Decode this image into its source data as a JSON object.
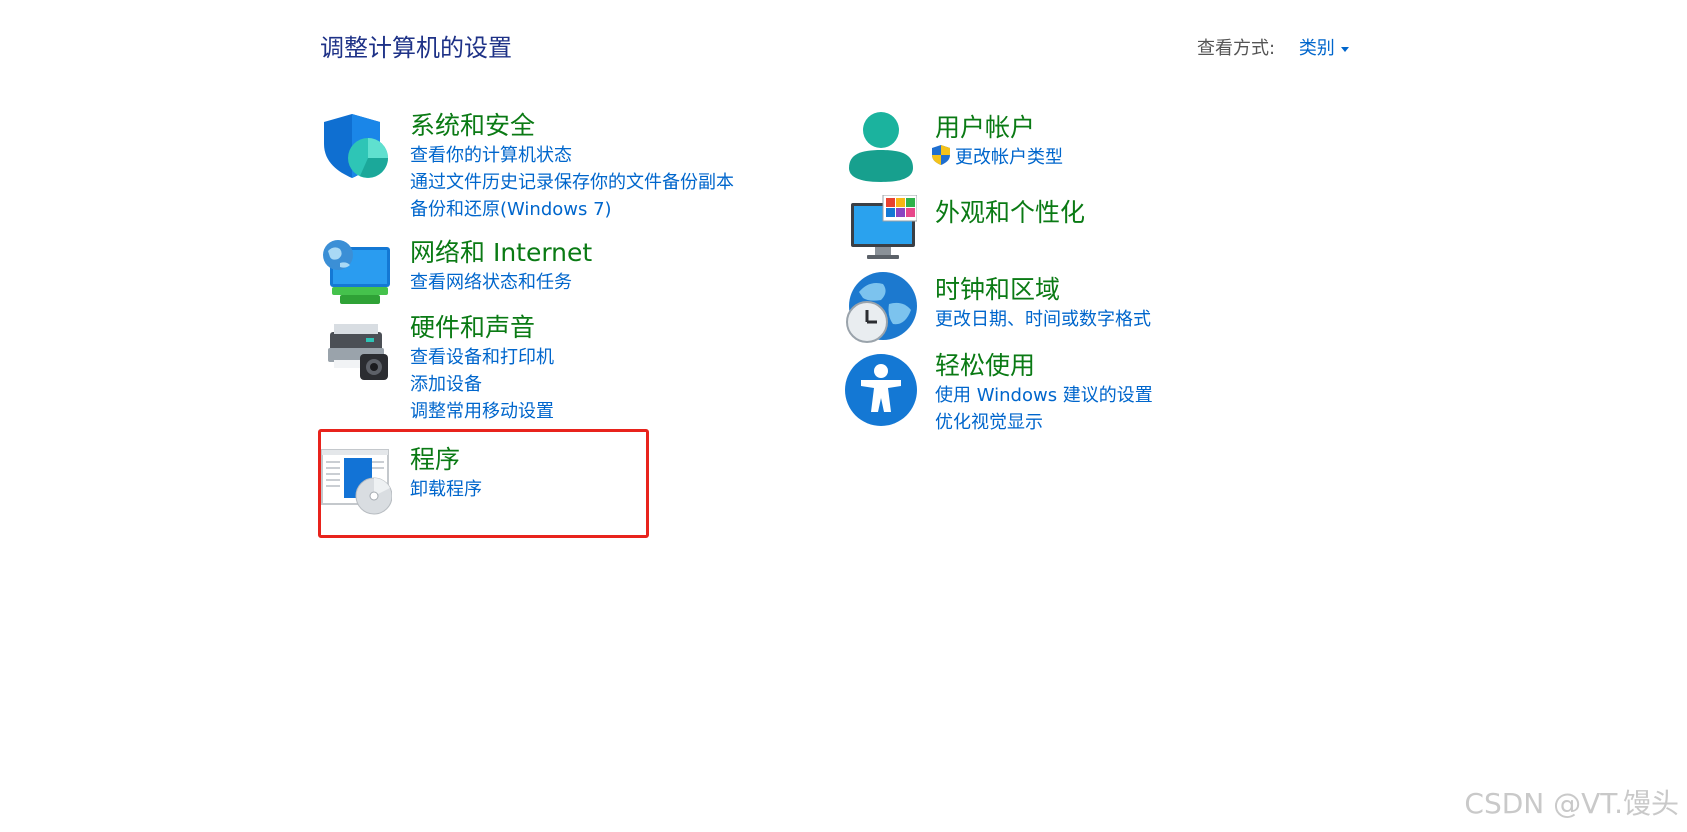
{
  "header": {
    "title": "调整计算机的设置",
    "view_by_label": "查看方式:",
    "view_by_value": "类别"
  },
  "categories": [
    {
      "title": "系统和安全",
      "icon": "security-shield-icon",
      "links": [
        "查看你的计算机状态",
        "通过文件历史记录保存你的文件备份副本",
        "备份和还原(Windows 7)"
      ]
    },
    {
      "title": "网络和 Internet",
      "icon": "network-globe-icon",
      "links": [
        "查看网络状态和任务"
      ]
    },
    {
      "title": "硬件和声音",
      "icon": "printer-icon",
      "links": [
        "查看设备和打印机",
        "添加设备",
        "调整常用移动设置"
      ]
    },
    {
      "title": "程序",
      "icon": "programs-disc-icon",
      "links": [
        "卸载程序"
      ]
    },
    {
      "title": "用户帐户",
      "icon": "user-account-icon",
      "links": [
        "更改帐户类型"
      ]
    },
    {
      "title": "外观和个性化",
      "icon": "monitor-personalization-icon",
      "links": []
    },
    {
      "title": "时钟和区域",
      "icon": "globe-clock-icon",
      "links": [
        "更改日期、时间或数字格式"
      ]
    },
    {
      "title": "轻松使用",
      "icon": "accessibility-icon",
      "links": [
        "使用 Windows 建议的设置",
        "优化视觉显示"
      ]
    }
  ],
  "colors": {
    "category_title": "#0a7a14",
    "link": "#0066cc",
    "highlight": "#e8231c",
    "page_title": "#1e3287"
  },
  "watermark": "CSDN @VT.馒头"
}
